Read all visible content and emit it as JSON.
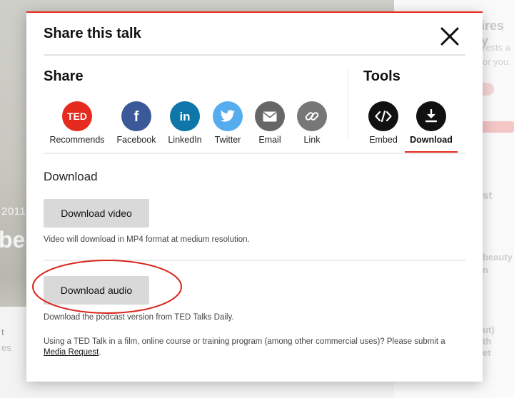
{
  "background": {
    "year": "2011",
    "big_text": "be",
    "left_t": "t",
    "left_es": "es",
    "right_texts": [
      "ires y",
      "rests a",
      "or you.",
      "st",
      "beauty",
      "n",
      "ut)",
      "th",
      "et"
    ]
  },
  "modal": {
    "title": "Share this talk",
    "share_heading": "Share",
    "tools_heading": "Tools",
    "share_items": [
      {
        "label": "Recommends",
        "icon": "ted-logo-icon",
        "color": "#e62b1e",
        "glyph": "TED"
      },
      {
        "label": "Facebook",
        "icon": "facebook-icon",
        "color": "#3b5998",
        "glyph": "f"
      },
      {
        "label": "LinkedIn",
        "icon": "linkedin-icon",
        "color": "#0e76a8",
        "glyph": "in"
      },
      {
        "label": "Twitter",
        "icon": "twitter-icon",
        "color": "#55acee",
        "glyph": "bird"
      },
      {
        "label": "Email",
        "icon": "email-icon",
        "color": "#666666",
        "glyph": "envelope"
      },
      {
        "label": "Link",
        "icon": "link-icon",
        "color": "#777777",
        "glyph": "chain"
      }
    ],
    "tool_items": [
      {
        "label": "Embed",
        "icon": "embed-code-icon",
        "color": "#111111",
        "glyph": "</>"
      },
      {
        "label": "Download",
        "icon": "download-icon",
        "color": "#111111",
        "glyph": "arrow-down",
        "active": true
      }
    ],
    "download": {
      "heading": "Download",
      "video_button": "Download video",
      "video_note": "Video will download in MP4 format at medium resolution.",
      "audio_button": "Download audio",
      "audio_note": "Download the podcast version from TED Talks Daily.",
      "usage_text": "Using a TED Talk in a film, online course or training program (among other commercial uses)? Please submit a",
      "usage_link": "Media Request",
      "usage_end": "."
    }
  },
  "colors": {
    "accent": "#e62b1e",
    "button_gray": "#d9d9d9",
    "annotation_circle": "#d9261c"
  }
}
